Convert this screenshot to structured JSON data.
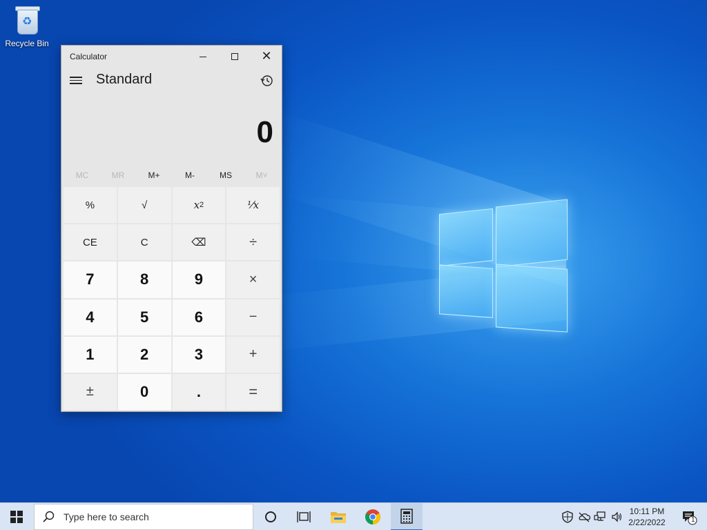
{
  "desktop": {
    "icons": [
      {
        "label": "Recycle Bin",
        "icon": "recycle-bin-icon"
      }
    ]
  },
  "calculator": {
    "window_title": "Calculator",
    "mode_title": "Standard",
    "display": "0",
    "memory_buttons": [
      {
        "label": "MC",
        "enabled": false
      },
      {
        "label": "MR",
        "enabled": false
      },
      {
        "label": "M+",
        "enabled": true
      },
      {
        "label": "M-",
        "enabled": true
      },
      {
        "label": "MS",
        "enabled": true
      },
      {
        "label": "M˅",
        "enabled": false
      }
    ],
    "keys": {
      "percent": "%",
      "sqrt": "√",
      "square_base": "x",
      "square_exp": "2",
      "reciprocal": "⅟x",
      "ce": "CE",
      "c": "C",
      "backspace": "⌫",
      "divide": "÷",
      "seven": "7",
      "eight": "8",
      "nine": "9",
      "multiply": "×",
      "four": "4",
      "five": "5",
      "six": "6",
      "minus": "−",
      "one": "1",
      "two": "2",
      "three": "3",
      "plus": "+",
      "negate": "±",
      "zero": "0",
      "decimal": ".",
      "equals": "="
    }
  },
  "taskbar": {
    "search_placeholder": "Type here to search",
    "time": "10:11 PM",
    "date": "2/22/2022",
    "notification_count": "1"
  }
}
